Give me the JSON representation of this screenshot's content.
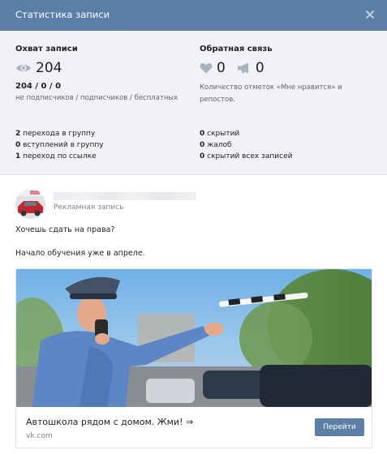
{
  "header": {
    "title": "Статистика записи",
    "close_icon": "close-icon"
  },
  "reach": {
    "title": "Охват записи",
    "icon": "eye-icon",
    "count": "204",
    "breakdown": "204 / 0 / 0",
    "breakdown_desc": "не подписчиков / подписчиков / бесплатных"
  },
  "feedback": {
    "title": "Обратная связь",
    "likes_icon": "heart-icon",
    "likes": "0",
    "shares_icon": "megaphone-icon",
    "shares": "0",
    "desc": "Количество отметок «Мне нравится» и репостов."
  },
  "left_list": [
    {
      "num": "2",
      "text": " перехода в группу"
    },
    {
      "num": "0",
      "text": " вступлений в группу"
    },
    {
      "num": "1",
      "text": " переход по ссылке"
    }
  ],
  "right_list": [
    {
      "num": "0",
      "text": " скрытий"
    },
    {
      "num": "0",
      "text": " жалоб"
    },
    {
      "num": "0",
      "text": " скрытий всех записей"
    }
  ],
  "post": {
    "ad_label": "Рекламная запись",
    "text_line1": "Хочешь сдать на права?",
    "text_line2": "Начало обучения уже в апреле.",
    "card": {
      "title": "Автошкола рядом с домом. Жми! ⇒",
      "domain": "vk.com",
      "button": "Перейти"
    }
  },
  "colors": {
    "header_bg": "#5b7fa6",
    "stats_bg": "#f0f2f5",
    "button_bg": "#5b7fa6"
  }
}
